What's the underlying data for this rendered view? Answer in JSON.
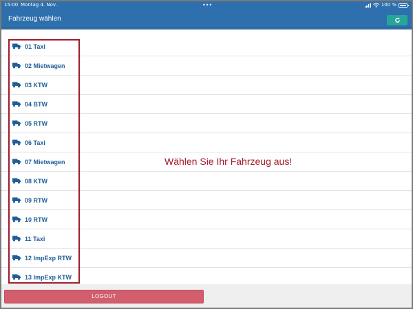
{
  "status_bar": {
    "time": "15:00",
    "date": "Montag 4. Nov.",
    "dots": "•••",
    "battery": "100 %"
  },
  "header": {
    "title": "Fahrzeug wählen"
  },
  "vehicles": [
    "01 Taxi",
    "02 Mietwagen",
    "03 KTW",
    "04 BTW",
    "05 RTW",
    "06 Taxi",
    "07 Mietwagen",
    "08 KTW",
    "09 RTW",
    "10 RTW",
    "11 Taxi",
    "12 ImpExp RTW",
    "13 ImpExp KTW"
  ],
  "main": {
    "prompt": "Wählen Sie Ihr Fahrzeug aus!"
  },
  "footer": {
    "logout_label": "LOGOUT"
  },
  "colors": {
    "header": "#2e6fad",
    "accent_green": "#26a69a",
    "vehicle_text": "#1f5e98",
    "prompt_text": "#a3192a",
    "logout": "#d15d6d"
  },
  "icons": {
    "vehicle": "truck-icon",
    "refresh": "refresh-icon",
    "wifi": "wifi-icon",
    "battery": "battery-icon",
    "signal": "signal-icon"
  }
}
